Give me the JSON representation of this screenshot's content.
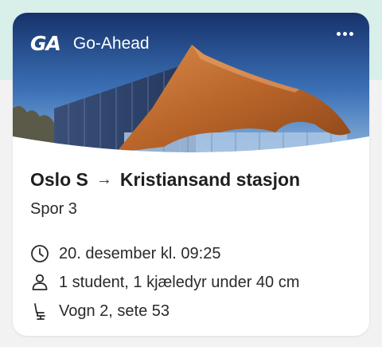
{
  "header": {
    "logo": "GA",
    "operator": "Go-Ahead",
    "menu_icon": "more-horizontal-icon"
  },
  "trip": {
    "from": "Oslo S",
    "arrow": "→",
    "to": "Kristiansand stasjon",
    "platform": "Spor 3"
  },
  "details": {
    "datetime": "20. desember kl. 09:25",
    "passengers": "1 student, 1 kjæledyr under 40 cm",
    "seat": "Vogn 2, sete 53"
  },
  "colors": {
    "page_top": "#d9efea",
    "page_bottom": "#f2f2f2",
    "card": "#ffffff",
    "roof": "#b9652a",
    "sky": "#2a5fa8"
  }
}
